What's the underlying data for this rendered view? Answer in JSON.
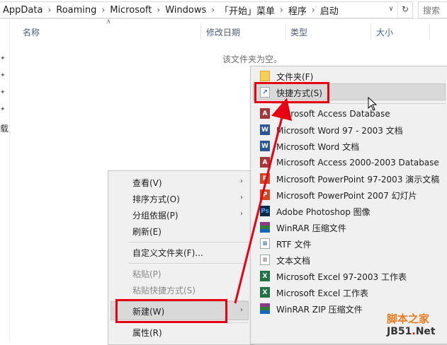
{
  "address_bar": {
    "crumbs": [
      "AppData",
      "Roaming",
      "Microsoft",
      "Windows",
      "「开始」菜单",
      "程序",
      "启动"
    ],
    "search_placeholder": "搜索"
  },
  "left_pane": {
    "truncated_char": "载"
  },
  "columns": {
    "name": "名称",
    "modified": "修改日期",
    "type": "类型",
    "size": "大小"
  },
  "empty_message": "该文件夹为空。",
  "context_menu": {
    "view": "查看(V)",
    "sort_by": "排序方式(O)",
    "group_by": "分组依据(P)",
    "refresh": "刷新(E)",
    "customize": "自定义文件夹(F)...",
    "paste": "粘贴(P)",
    "paste_shortcut": "粘贴快捷方式(S)",
    "new": "新建(W)",
    "properties": "属性(R)"
  },
  "new_submenu": [
    {
      "label": "文件夹(F)",
      "icon": "folder-icon"
    },
    {
      "label": "快捷方式(S)",
      "icon": "shortcut-icon"
    },
    {
      "label": "Microsoft Access Database",
      "icon": "access-icon"
    },
    {
      "label": "Microsoft Word 97 - 2003 文档",
      "icon": "word-icon"
    },
    {
      "label": "Microsoft Word 文档",
      "icon": "word-icon"
    },
    {
      "label": "Microsoft Access 2000-2003 Database",
      "icon": "access-icon"
    },
    {
      "label": "Microsoft PowerPoint 97-2003 演示文稿",
      "icon": "powerpoint-icon"
    },
    {
      "label": "Microsoft PowerPoint 2007 幻灯片",
      "icon": "powerpoint-icon"
    },
    {
      "label": "Adobe Photoshop 图像",
      "icon": "photoshop-icon"
    },
    {
      "label": "WinRAR 压缩文件",
      "icon": "winrar-icon"
    },
    {
      "label": "RTF 文件",
      "icon": "rtf-icon"
    },
    {
      "label": "文本文档",
      "icon": "text-icon"
    },
    {
      "label": "Microsoft Excel 97-2003 工作表",
      "icon": "excel-icon"
    },
    {
      "label": "Microsoft Excel 工作表",
      "icon": "excel-icon"
    },
    {
      "label": "WinRAR ZIP 压缩文件",
      "icon": "winrar-icon"
    }
  ],
  "watermark": {
    "line1": "脚本之家",
    "line2a": "JB51",
    "line2b": ".",
    "line2c": "Net"
  },
  "colors": {
    "highlight": "#e60012",
    "menu_bg": "#f0f0f0"
  }
}
